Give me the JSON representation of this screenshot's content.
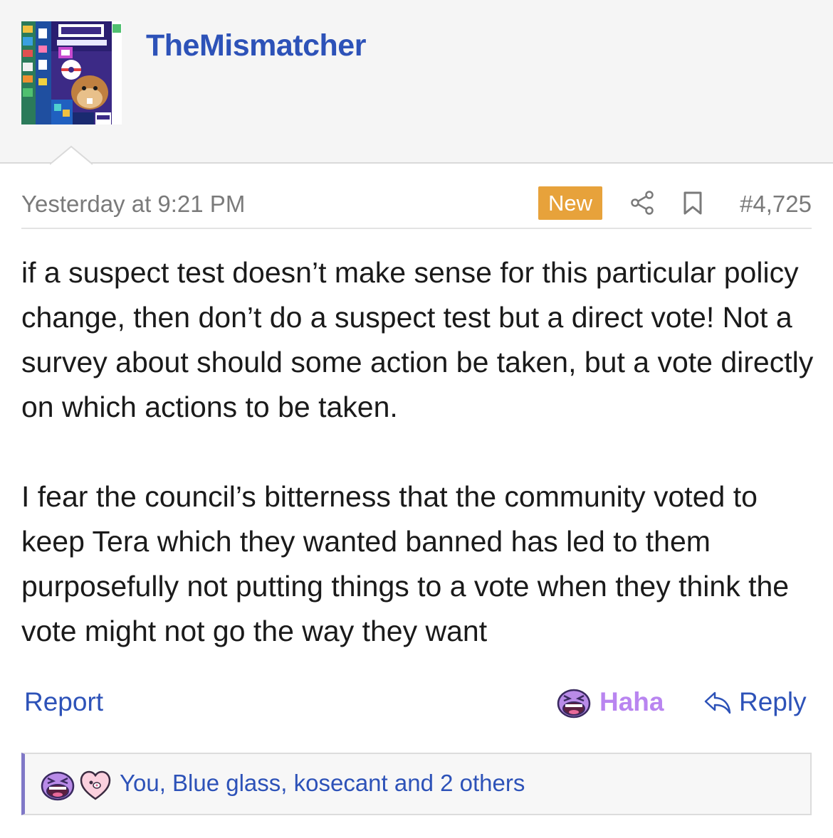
{
  "user": {
    "name": "TheMismatcher",
    "avatar_icon": "podcast-pixel-avatar"
  },
  "post": {
    "timestamp": "Yesterday at 9:21 PM",
    "badge": "New",
    "number": "#4,725",
    "paragraphs": [
      "if a suspect test doesn’t make sense for this particular policy change, then don’t do a suspect test but a direct vote! Not a survey about should some action be taken, but a vote directly on which actions to be taken.",
      "I fear the council’s bitterness that the community voted to keep Tera which they wanted banned has led to them purposefully not putting things to a vote when they think the vote might not go the way they want"
    ]
  },
  "actions": {
    "report": "Report",
    "haha": "Haha",
    "reply": "Reply"
  },
  "reactions": {
    "summary": "You, Blue glass, kosecant and 2 others",
    "icons": [
      "haha-face-icon",
      "love-heart-icon"
    ]
  },
  "colors": {
    "link": "#2d52b8",
    "badge": "#e7a23b",
    "haha": "#b985f0",
    "reaction_bar_accent": "#8078c7"
  }
}
